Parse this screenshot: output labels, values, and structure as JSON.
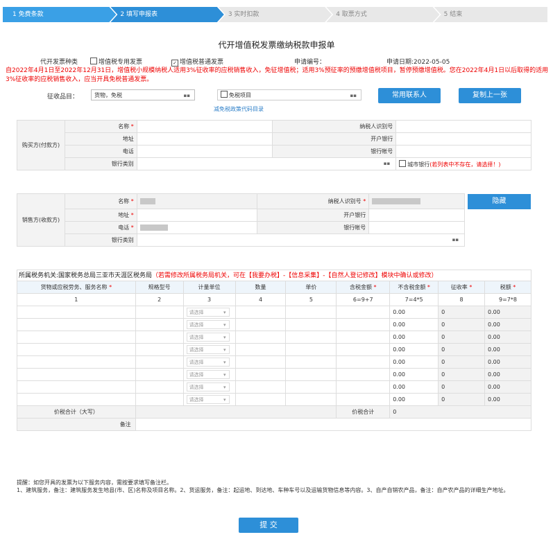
{
  "steps": [
    {
      "label": "1 免费条款",
      "state": "done"
    },
    {
      "label": "2 填写申报表",
      "state": "active"
    },
    {
      "label": "3 实时扣款",
      "state": "todo"
    },
    {
      "label": "4 取票方式",
      "state": "todo"
    },
    {
      "label": "5 结束",
      "state": "todo"
    }
  ],
  "title": "代开增值税发票缴纳税款申报单",
  "info": {
    "invoice_type_label": "代开发票种类",
    "option_special": "增值税专用发票",
    "option_normal": "增值税普通发票",
    "apply_no_label": "申请编号：",
    "apply_date": "申请日期:2022-05-05"
  },
  "notice": "自2022年4月1日至2022年12月31日，增值税小规模纳税人适用3%征收率的应税销售收入，免征增值税；适用3%预征率的预缴增值税项目，暂停预缴增值税。您在2022年4月1日以后取得的适用3%征收率的应税销售收入，应当开具免税普通发票。",
  "tax_item": {
    "label": "征收品目：",
    "value": "货物，免税",
    "exempt_label": "免税项目",
    "exempt_link": "减免税政策代码目录",
    "contacts_btn": "常用联系人",
    "copy_btn": "复制上一张"
  },
  "buyer": {
    "group": "购买方(付款方)",
    "name": "名称",
    "tax_id": "纳税人识别号",
    "address": "地址",
    "bank": "开户银行",
    "phone": "电话",
    "account": "银行帐号",
    "bank_type": "银行类别",
    "city_bank": "城市银行",
    "city_bank_note": "(若列表中不存在，请选择！)"
  },
  "seller": {
    "group": "销售方(收款方)",
    "name": "名称",
    "tax_id": "纳税人识别号",
    "address": "地址",
    "bank": "开户银行",
    "phone": "电话",
    "account": "银行帐号",
    "bank_type": "银行类别",
    "hide_btn": "隐藏"
  },
  "tax_office": {
    "prefix": "所属税务机关:国家税务总局三亚市天涯区税务局",
    "note": "（若需修改所属税务局机关，可在【我要办税】-【信息采集】-【自然人登记修改】模块中确认或修改）"
  },
  "goods": {
    "headers": [
      "货物或应税劳务、服务名称",
      "规格型号",
      "计量单位",
      "数量",
      "单价",
      "含税金额",
      "不含税金额",
      "征收率",
      "税额"
    ],
    "required": [
      true,
      false,
      false,
      false,
      false,
      true,
      true,
      true,
      true
    ],
    "nums": [
      "1",
      "2",
      "3",
      "4",
      "5",
      "6=9+7",
      "7=4*5",
      "8",
      "9=7*8"
    ],
    "select_placeholder": "请选择",
    "row_values": [
      "0.00",
      "0",
      "0.00"
    ],
    "total_upper_label": "价税合计（大写）",
    "total_label": "价税合计",
    "total_value": "0",
    "remark_label": "备注"
  },
  "hint": {
    "line1": "提醒：如您开具的发票为以下服务内容，需按要求填写备注栏。",
    "line2": "1、建筑服务，备注：建筑服务发生地县(市、区)名称及项目名称。2、货运服务，备注：起运地、到达地、车种车号以及运输货物信息等内容。3、自产自销农产品，备注：自产农产品的详细生产地址。"
  },
  "submit": "提 交"
}
